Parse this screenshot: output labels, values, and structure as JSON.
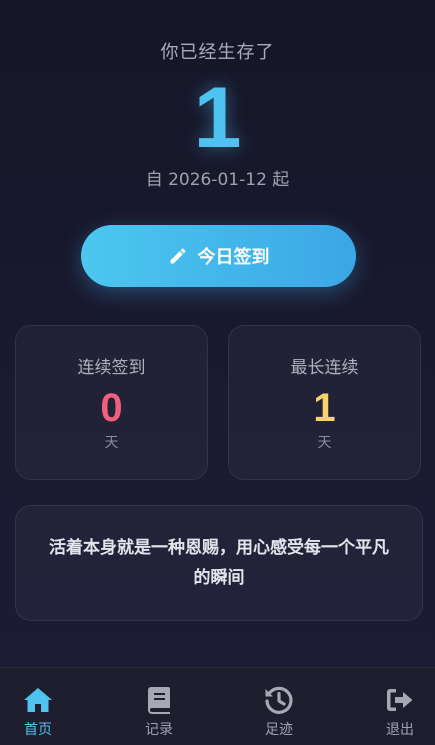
{
  "hero": {
    "headline": "你已经生存了",
    "days": "1",
    "since_text": "自 2026-01-12 起"
  },
  "checkin_button": {
    "label": "今日签到",
    "icon": "pencil-icon"
  },
  "stats": [
    {
      "label": "连续签到",
      "value": "0",
      "unit": "天",
      "color": "#f0607e"
    },
    {
      "label": "最长连续",
      "value": "1",
      "unit": "天",
      "color": "#f7d26a"
    }
  ],
  "quote": {
    "text": "活着本身就是一种恩赐，用心感受每一个平凡的瞬间"
  },
  "nav": [
    {
      "label": "首页",
      "icon": "home-icon",
      "active": true
    },
    {
      "label": "记录",
      "icon": "book-icon",
      "active": false
    },
    {
      "label": "足迹",
      "icon": "history-icon",
      "active": false
    },
    {
      "label": "退出",
      "icon": "logout-icon",
      "active": false
    }
  ],
  "colors": {
    "accent": "#4fc3ef",
    "background": "#161628",
    "streak": "#f0607e",
    "longest": "#f7d26a"
  }
}
